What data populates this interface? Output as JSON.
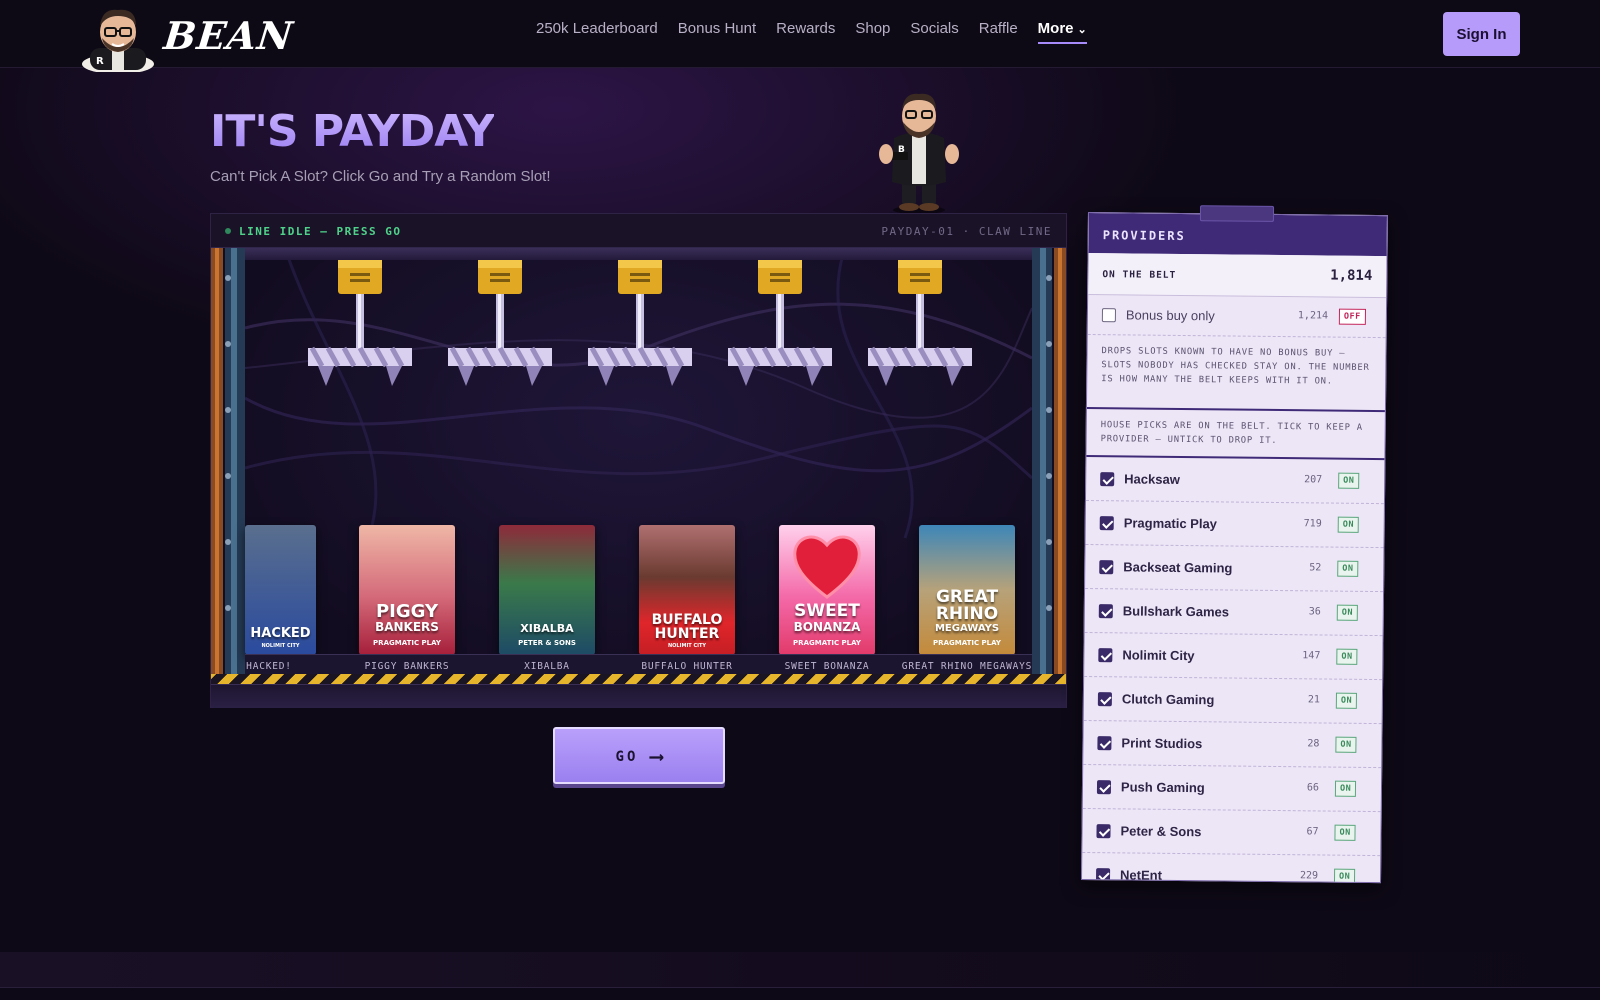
{
  "brand": {
    "name": "BEAN"
  },
  "nav": {
    "items": [
      {
        "label": "250k Leaderboard"
      },
      {
        "label": "Bonus Hunt"
      },
      {
        "label": "Rewards"
      },
      {
        "label": "Shop"
      },
      {
        "label": "Socials"
      },
      {
        "label": "Raffle"
      }
    ],
    "more_label": "More",
    "signin_label": "Sign In"
  },
  "hero": {
    "title": "IT'S PAYDAY",
    "subtitle": "Can't Pick A Slot? Click Go and Try a Random Slot!"
  },
  "machine": {
    "status": "LINE IDLE — PRESS GO",
    "id_label": "PAYDAY-01 · CLAW LINE",
    "go_label": "GO",
    "go_arrow": "⟶",
    "cards": [
      {
        "label": "HACKED!",
        "art_title": "HACKED",
        "art_sub": "NOLIMIT CITY",
        "color_top": "#2e4f9e",
        "color_bottom": "#1b2f6a"
      },
      {
        "label": "PIGGY BANKERS",
        "art_title": "PIGGY",
        "art_title2": "BANKERS",
        "art_sub": "PRAGMATIC PLAY",
        "color_top": "#e7a3a6",
        "color_bottom": "#b3263f"
      },
      {
        "label": "XIBALBA",
        "art_title": "XIBALBA",
        "art_sub": "PETER & SONS",
        "color_top": "#8e2a3a",
        "color_bottom": "#1d4a66"
      },
      {
        "label": "BUFFALO HUNTER",
        "art_title": "BUFFALO",
        "art_title2": "HUNTER",
        "art_sub": "NOLIMIT CITY",
        "color_top": "#8c3a3a",
        "color_bottom": "#e0262b"
      },
      {
        "label": "SWEET BONANZA",
        "art_title": "SWEET",
        "art_title2": "BONANZA",
        "art_sub": "PRAGMATIC PLAY",
        "color_top": "#f46aa9",
        "color_bottom": "#e23a6a"
      },
      {
        "label": "GREAT RHINO MEGAWAYS",
        "art_title": "GREAT",
        "art_title2": "RHINO",
        "art_title3": "MEGAWAYS",
        "art_sub": "PRAGMATIC PLAY",
        "color_top": "#3d86b8",
        "color_bottom": "#c48a3a"
      }
    ]
  },
  "providers": {
    "title": "PROVIDERS",
    "on_belt_label": "ON THE BELT",
    "on_belt_count": "1,814",
    "bonus_buy": {
      "label": "Bonus buy only",
      "count": "1,214",
      "state": "OFF"
    },
    "note1": "DROPS SLOTS KNOWN TO HAVE NO BONUS BUY — SLOTS NOBODY HAS CHECKED STAY ON. THE NUMBER IS HOW MANY THE BELT KEEPS WITH IT ON.",
    "note2": "HOUSE PICKS ARE ON THE BELT. TICK TO KEEP A PROVIDER — UNTICK TO DROP IT.",
    "list": [
      {
        "name": "Hacksaw",
        "count": "207",
        "state": "ON"
      },
      {
        "name": "Pragmatic Play",
        "count": "719",
        "state": "ON"
      },
      {
        "name": "Backseat Gaming",
        "count": "52",
        "state": "ON"
      },
      {
        "name": "Bullshark Games",
        "count": "36",
        "state": "ON"
      },
      {
        "name": "Nolimit City",
        "count": "147",
        "state": "ON"
      },
      {
        "name": "Clutch Gaming",
        "count": "21",
        "state": "ON"
      },
      {
        "name": "Print Studios",
        "count": "28",
        "state": "ON"
      },
      {
        "name": "Push Gaming",
        "count": "66",
        "state": "ON"
      },
      {
        "name": "Peter & Sons",
        "count": "67",
        "state": "ON"
      },
      {
        "name": "NetEnt",
        "count": "229",
        "state": "ON"
      }
    ]
  },
  "colors": {
    "accent": "#b79bfb",
    "panel_header": "#3f2a78",
    "status_green": "#4fd38a",
    "hazard_yellow": "#e7b52b"
  }
}
